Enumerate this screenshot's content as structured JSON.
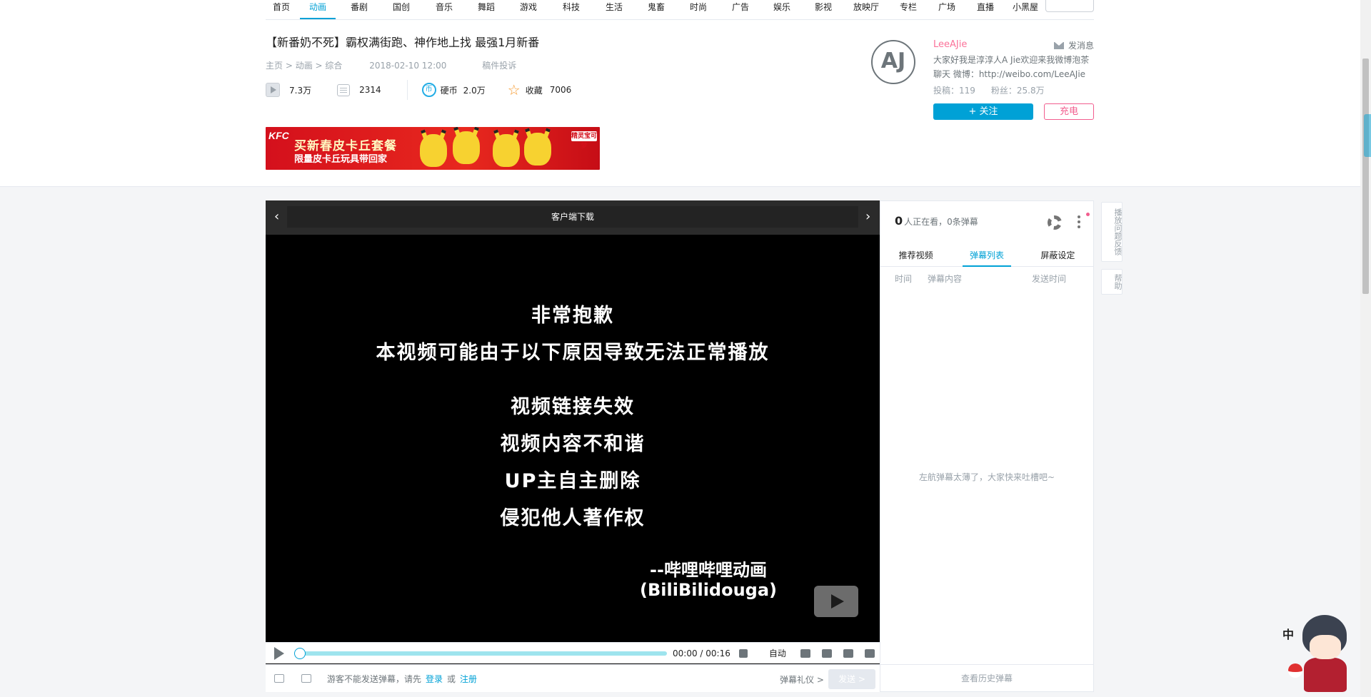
{
  "nav": {
    "items": [
      "首页",
      "动画",
      "番剧",
      "国创",
      "音乐",
      "舞蹈",
      "游戏",
      "科技",
      "生活",
      "鬼畜",
      "时尚",
      "广告",
      "娱乐",
      "影视",
      "放映厅",
      "专栏",
      "广场",
      "直播",
      "小黑屋"
    ],
    "active_index": 1
  },
  "video": {
    "title": "【新番奶不死】霸权满街跑、神作地上找 最强1月新番",
    "breadcrumb": [
      "主页",
      "动画",
      "综合"
    ],
    "breadcrumb_sep": " > ",
    "date": "2018-02-10 12:00",
    "report": "稿件投诉",
    "views": "7.3万",
    "danmaku_count": "2314",
    "coin_label": "硬币",
    "coins": "2.0万",
    "fav_label": "收藏",
    "favs": "7006"
  },
  "ad": {
    "brand": "KFC",
    "line1": "买新春皮卡丘套餐",
    "line2": "限量皮卡丘玩具带回家",
    "logo": "精灵宝可梦"
  },
  "uploader": {
    "avatar_text": "AJ",
    "name": "LeeAJie",
    "message_label": "发消息",
    "desc": "大家好我是淳淳人A Jie欢迎来我微博泡茶聊天 微博：http://weibo.com/LeeAJie",
    "posts": "投稿：119",
    "fans": "粉丝：25.8万",
    "follow_label": "+ 关注",
    "charge_label": "充电"
  },
  "player": {
    "top_bar": "客户端下载",
    "prev_arrow": "‹",
    "next_arrow": "›",
    "error_lines": [
      "非常抱歉",
      "本视频可能由于以下原因导致无法正常播放",
      "视频链接失效",
      "视频内容不和谐",
      "UP主自主删除",
      "侵犯他人著作权"
    ],
    "signature_line1": "--哔哩哔哩动画",
    "signature_line2": "(BiliBilidouga)",
    "time_current": "00:00",
    "time_total": "00:16",
    "time_sep": " / ",
    "quality": "自动",
    "progress": 0,
    "dm_notice": "游客不能发送弹幕，请先",
    "dm_login": "登录",
    "dm_or": "或",
    "dm_register": "注册",
    "dm_etiquette": "弹幕礼仪 >",
    "dm_send": "发送 >"
  },
  "panel": {
    "watching_count": "0",
    "watching_text": "人正在看，0条弹幕",
    "tabs": [
      "推荐视频",
      "弹幕列表",
      "屏蔽设定"
    ],
    "active_tab": 1,
    "columns": [
      "时间",
      "弹幕内容",
      "发送时间"
    ],
    "empty_text": "左航弹幕太薄了，大家快来吐槽吧~",
    "history": "查看历史弹幕"
  },
  "side_tools": [
    "播放问题反馈",
    "帮助"
  ],
  "mascot": {
    "label": "中"
  }
}
